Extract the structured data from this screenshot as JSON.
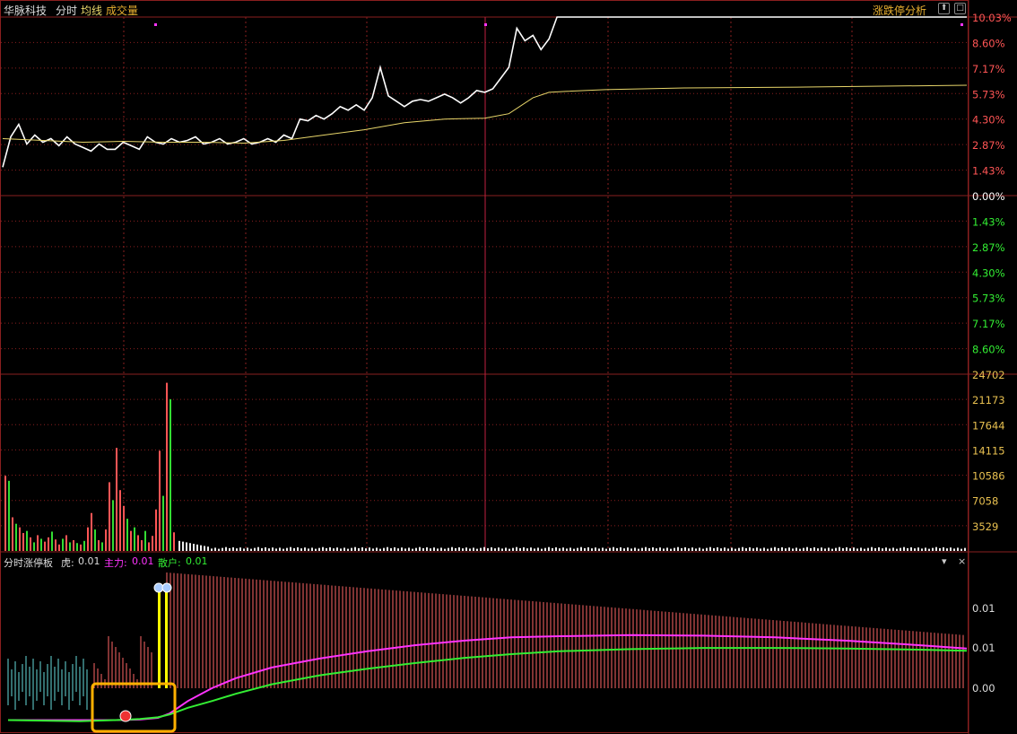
{
  "header": {
    "stock_name": "华脉科技",
    "tab_intraday": "分时",
    "legend_avg": "均线",
    "legend_volume": "成交量",
    "analysis_link": "涨跌停分析",
    "btn_up": "⬆",
    "btn_box": "□"
  },
  "indicator": {
    "name": "分时涨停板",
    "tiger_label": "虎:",
    "tiger_value": "0.01",
    "main_label": "主力:",
    "main_value": "0.01",
    "retail_label": "散户:",
    "retail_value": "0.01",
    "menu_icon": "▾",
    "close_icon": "×"
  },
  "colors": {
    "price": "#ffffff",
    "avg": "#e8d66a",
    "up": "#ff5555",
    "down": "#33dd33",
    "grid": "#8a1f1f",
    "axis_text": "#e8c050",
    "main": "#ff33ff",
    "retail": "#33ee33",
    "tiger_up": "#ff6666",
    "tiger_down": "#66dddd",
    "highlight": "#ffb000"
  },
  "chart_data": [
    {
      "type": "line",
      "title": "分时",
      "ylim": [
        -10.03,
        10.03
      ],
      "x_count": 241,
      "series": [
        {
          "name": "分时",
          "points": [
            [
              0,
              1.6
            ],
            [
              2,
              3.3
            ],
            [
              4,
              4.0
            ],
            [
              6,
              2.9
            ],
            [
              8,
              3.4
            ],
            [
              10,
              3.0
            ],
            [
              12,
              3.2
            ],
            [
              14,
              2.8
            ],
            [
              16,
              3.3
            ],
            [
              18,
              2.9
            ],
            [
              20,
              2.7
            ],
            [
              22,
              2.5
            ],
            [
              24,
              2.9
            ],
            [
              26,
              2.6
            ],
            [
              28,
              2.6
            ],
            [
              30,
              3.0
            ],
            [
              32,
              2.8
            ],
            [
              34,
              2.6
            ],
            [
              36,
              3.3
            ],
            [
              38,
              3.0
            ],
            [
              40,
              2.9
            ],
            [
              42,
              3.2
            ],
            [
              44,
              3.0
            ],
            [
              46,
              3.1
            ],
            [
              48,
              3.3
            ],
            [
              50,
              2.9
            ],
            [
              52,
              3.0
            ],
            [
              54,
              3.2
            ],
            [
              56,
              2.9
            ],
            [
              58,
              3.0
            ],
            [
              60,
              3.2
            ],
            [
              62,
              2.9
            ],
            [
              64,
              3.0
            ],
            [
              66,
              3.2
            ],
            [
              68,
              3.0
            ],
            [
              70,
              3.4
            ],
            [
              72,
              3.2
            ],
            [
              74,
              4.3
            ],
            [
              76,
              4.2
            ],
            [
              78,
              4.5
            ],
            [
              80,
              4.3
            ],
            [
              82,
              4.6
            ],
            [
              84,
              5.0
            ],
            [
              86,
              4.8
            ],
            [
              88,
              5.1
            ],
            [
              90,
              4.8
            ],
            [
              92,
              5.5
            ],
            [
              94,
              7.2
            ],
            [
              96,
              5.6
            ],
            [
              98,
              5.3
            ],
            [
              100,
              5.0
            ],
            [
              102,
              5.3
            ],
            [
              104,
              5.4
            ],
            [
              106,
              5.3
            ],
            [
              108,
              5.5
            ],
            [
              110,
              5.7
            ],
            [
              112,
              5.5
            ],
            [
              114,
              5.2
            ],
            [
              116,
              5.5
            ],
            [
              118,
              5.9
            ],
            [
              120,
              5.8
            ],
            [
              122,
              6.0
            ],
            [
              124,
              6.6
            ],
            [
              126,
              7.2
            ],
            [
              128,
              9.4
            ],
            [
              130,
              8.7
            ],
            [
              132,
              9.0
            ],
            [
              134,
              8.2
            ],
            [
              136,
              8.8
            ],
            [
              138,
              10.03
            ],
            [
              240,
              10.03
            ]
          ]
        },
        {
          "name": "均线",
          "points": [
            [
              0,
              3.2
            ],
            [
              10,
              3.1
            ],
            [
              20,
              3.0
            ],
            [
              30,
              3.05
            ],
            [
              40,
              3.0
            ],
            [
              50,
              3.0
            ],
            [
              60,
              2.95
            ],
            [
              70,
              3.1
            ],
            [
              80,
              3.4
            ],
            [
              90,
              3.7
            ],
            [
              100,
              4.1
            ],
            [
              110,
              4.3
            ],
            [
              120,
              4.35
            ],
            [
              126,
              4.6
            ],
            [
              132,
              5.5
            ],
            [
              136,
              5.8
            ],
            [
              140,
              5.85
            ],
            [
              150,
              5.95
            ],
            [
              170,
              6.05
            ],
            [
              200,
              6.1
            ],
            [
              240,
              6.2
            ]
          ]
        }
      ],
      "y_tick_labels": [
        "10.03%",
        "8.60%",
        "7.17%",
        "5.73%",
        "4.30%",
        "2.87%",
        "1.43%",
        "0.00%",
        "1.43%",
        "2.87%",
        "4.30%",
        "5.73%",
        "7.17%",
        "8.60%"
      ]
    },
    {
      "type": "bar",
      "title": "成交量",
      "ylim": [
        0,
        24702
      ],
      "y_tick_labels": [
        "24702",
        "21173",
        "17644",
        "14115",
        "10586",
        "7058",
        "3529"
      ]
    },
    {
      "type": "line",
      "title": "分时涨停板",
      "y_tick_labels": [
        "0.01",
        "0.01",
        "0.00"
      ],
      "series": [
        {
          "name": "主力",
          "points": [
            [
              0,
              -0.12
            ],
            [
              60,
              -0.12
            ],
            [
              90,
              -0.12
            ],
            [
              110,
              -0.11
            ],
            [
              125,
              -0.08
            ],
            [
              135,
              0.0
            ],
            [
              150,
              0.22
            ],
            [
              170,
              0.45
            ],
            [
              190,
              0.63
            ],
            [
              220,
              0.82
            ],
            [
              260,
              0.98
            ],
            [
              300,
              1.11
            ],
            [
              340,
              1.22
            ],
            [
              380,
              1.3
            ],
            [
              420,
              1.36
            ],
            [
              460,
              1.38
            ],
            [
              520,
              1.4
            ],
            [
              580,
              1.39
            ],
            [
              640,
              1.36
            ],
            [
              700,
              1.3
            ],
            [
              760,
              1.22
            ],
            [
              800,
              1.16
            ]
          ]
        },
        {
          "name": "散户",
          "points": [
            [
              0,
              -0.12
            ],
            [
              60,
              -0.14
            ],
            [
              90,
              -0.12
            ],
            [
              110,
              -0.1
            ],
            [
              125,
              -0.07
            ],
            [
              135,
              -0.02
            ],
            [
              150,
              0.1
            ],
            [
              170,
              0.22
            ],
            [
              190,
              0.35
            ],
            [
              220,
              0.52
            ],
            [
              260,
              0.68
            ],
            [
              300,
              0.8
            ],
            [
              340,
              0.9
            ],
            [
              380,
              0.99
            ],
            [
              420,
              1.06
            ],
            [
              460,
              1.11
            ],
            [
              520,
              1.15
            ],
            [
              580,
              1.17
            ],
            [
              640,
              1.17
            ],
            [
              700,
              1.16
            ],
            [
              760,
              1.14
            ],
            [
              800,
              1.12
            ]
          ]
        }
      ]
    }
  ]
}
